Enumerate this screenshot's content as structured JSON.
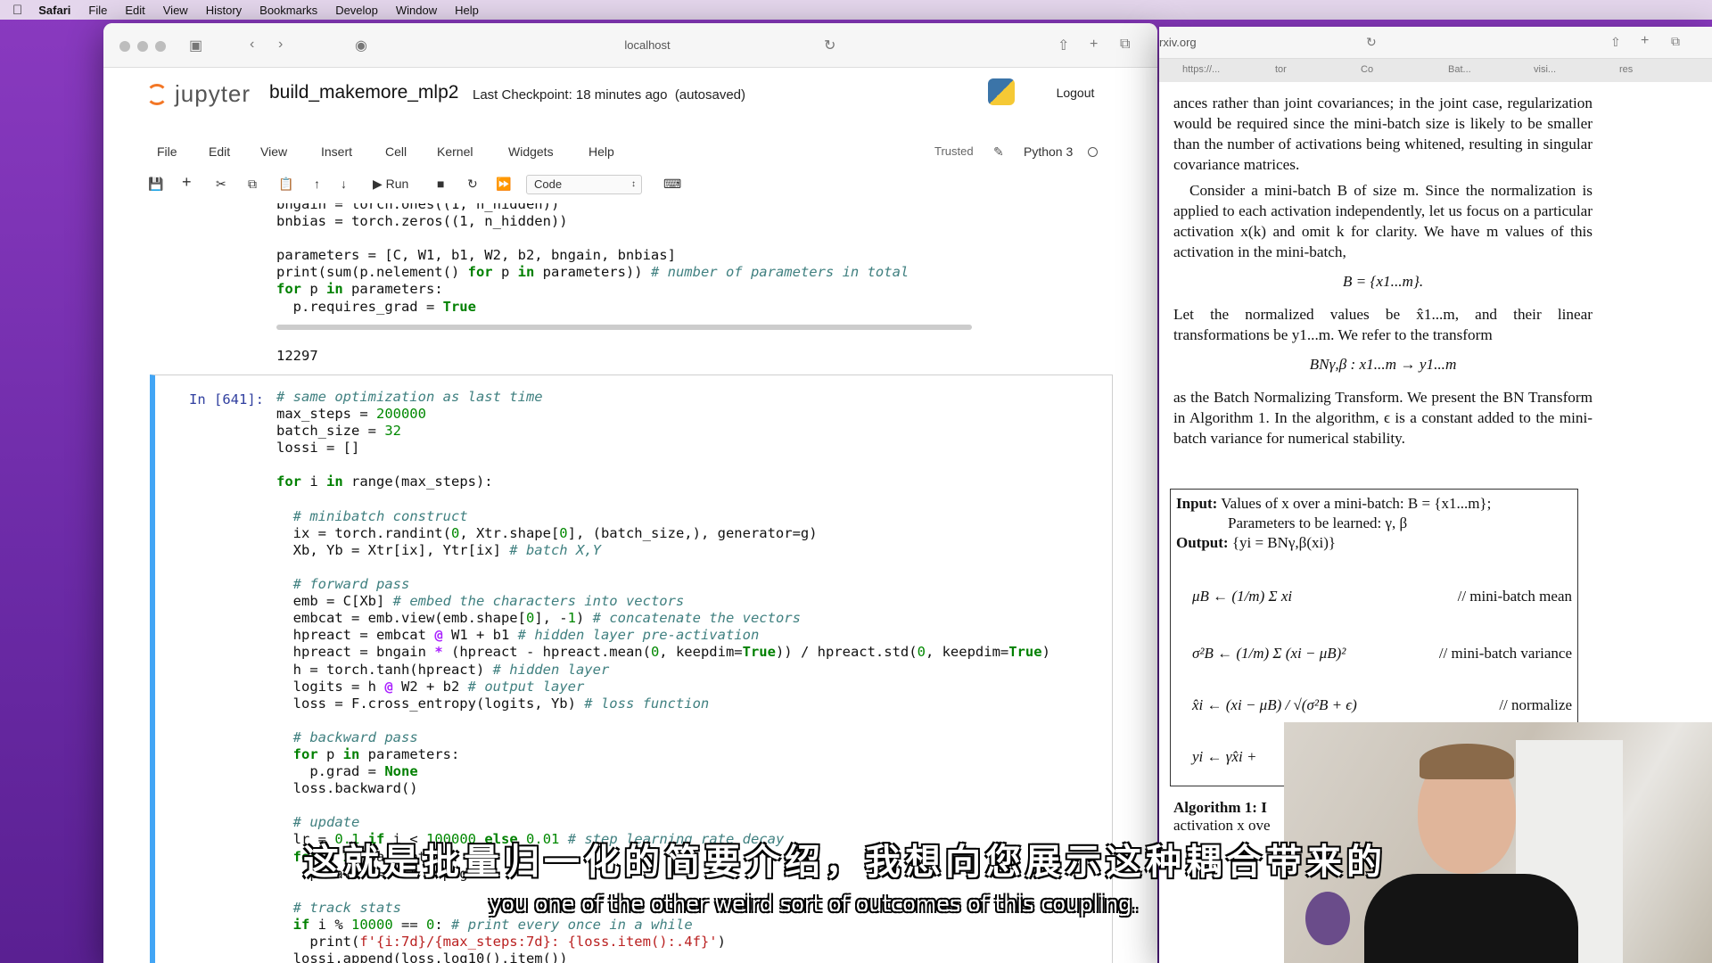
{
  "menubar": {
    "app": "Safari",
    "items": [
      "File",
      "Edit",
      "View",
      "History",
      "Bookmarks",
      "Develop",
      "Window",
      "Help"
    ]
  },
  "safari": {
    "url": "localhost"
  },
  "jupyter": {
    "logo": "jupyter",
    "notebook_name": "build_makemore_mlp2",
    "checkpoint": "Last Checkpoint: 18 minutes ago",
    "autosaved": "(autosaved)",
    "logout": "Logout",
    "menu": [
      "File",
      "Edit",
      "View",
      "Insert",
      "Cell",
      "Kernel",
      "Widgets",
      "Help"
    ],
    "trusted": "Trusted",
    "kernel": "Python 3",
    "toolbar": {
      "run": "Run",
      "cell_type": "Code"
    },
    "prev_output": "12297",
    "prompt": "In [641]:"
  },
  "paper": {
    "url": "rxiv.org",
    "tabs": [
      "https://...",
      "tor",
      "Co",
      "Bat...",
      "visi...",
      "res"
    ],
    "p1": "ances rather than joint covariances; in the joint case, regularization would be required since the mini-batch size is likely to be smaller than the number of activations being whitened, resulting in singular covariance matrices.",
    "p2": "Consider a mini-batch B of size m. Since the normalization is applied to each activation independently, let us focus on a particular activation x(k) and omit k for clarity. We have m values of this activation in the mini-batch,",
    "eq1": "B = {x1...m}.",
    "p3": "Let the normalized values be x̂1...m, and their linear transformations be y1...m. We refer to the transform",
    "eq2": "BNγ,β : x1...m → y1...m",
    "p4": "as the Batch Normalizing Transform. We present the BN Transform in Algorithm 1. In the algorithm, ϵ is a constant added to the mini-batch variance for numerical stability.",
    "algo": {
      "input": "Input:",
      "input_text": "Values of x over a mini-batch: B = {x1...m};",
      "params": "Parameters to be learned: γ, β",
      "output": "Output:",
      "output_text": "{yi = BNγ,β(xi)}",
      "mean_eq": "μB ← (1/m) Σ xi",
      "mean_cmt": "// mini-batch mean",
      "var_eq": "σ²B ← (1/m) Σ (xi − μB)²",
      "var_cmt": "// mini-batch variance",
      "norm_eq": "x̂i ← (xi − μB) / √(σ²B + ϵ)",
      "norm_cmt": "// normalize",
      "scale_eq": "yi ← γx̂i +"
    },
    "caption": "Algorithm 1: I",
    "caption2": "activation x ove"
  },
  "subtitles": {
    "cn": "这就是批量归一化的简要介绍，我想向您展示这种耦合带来的",
    "en": "you one of the other weird sort of outcomes of this coupling."
  }
}
